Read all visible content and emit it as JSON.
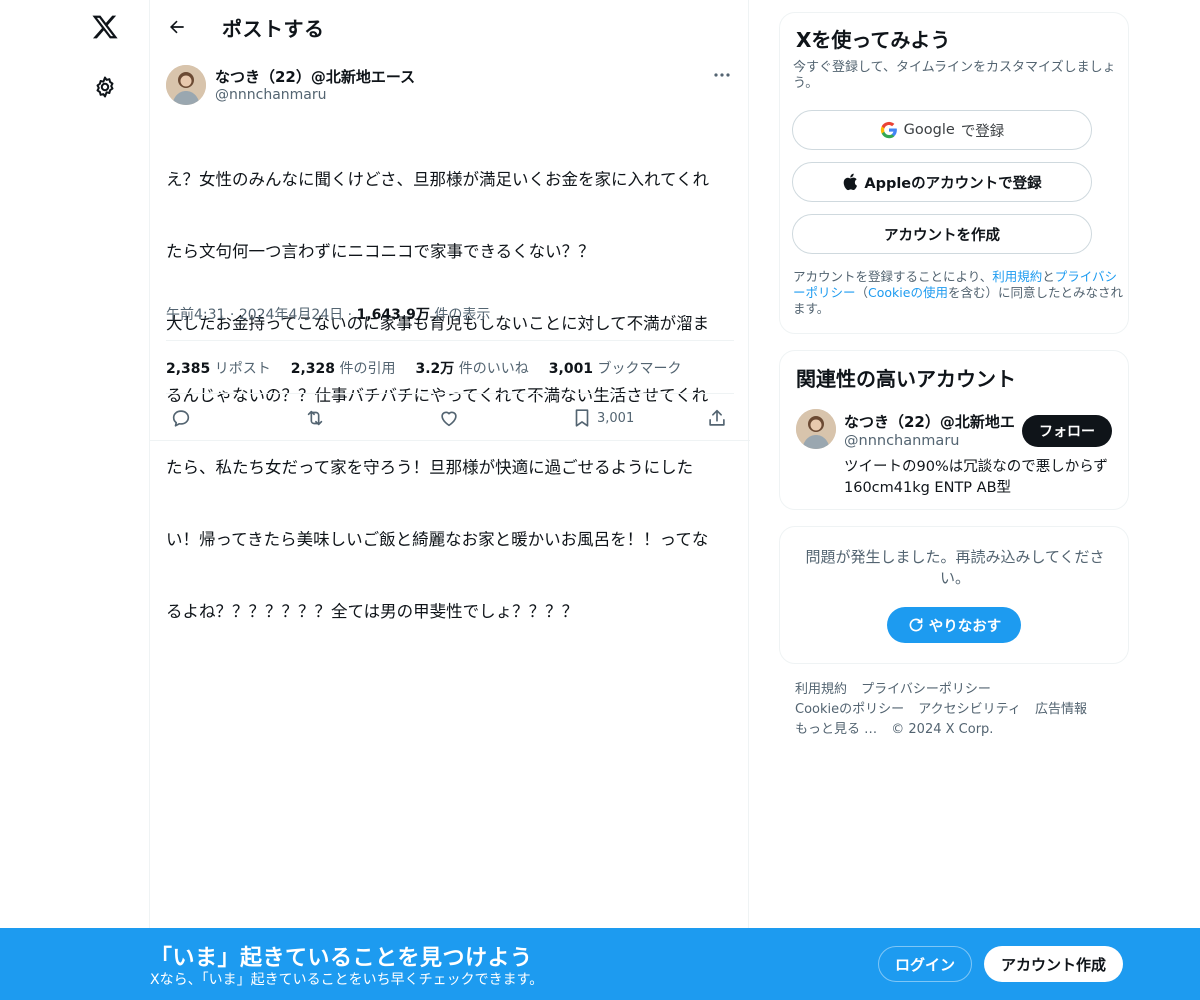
{
  "nav": {
    "logo_icon": "x-logo-icon",
    "settings_icon": "gear-icon"
  },
  "header": {
    "title": "ポストする",
    "back_icon": "arrow-left-icon"
  },
  "post": {
    "author_name": "なつき（22）@北新地エース",
    "author_handle": "@nnnchanmaru",
    "text_lines": [
      "え？女性のみんなに聞くけどさ、旦那様が満足いくお金を家に入れてくれ",
      "たら文句何一つ言わずにニコニコで家事できるくない？？",
      "大したお金持ってこないのに家事も育児もしないことに対して不満が溜ま",
      "るんじゃないの？？仕事バチバチにやってくれて不満ない生活させてくれ",
      "たら、私たち女だって家を守ろう！旦那様が快適に過ごせるようにした",
      "い！帰ってきたら美味しいご飯と綺麗なお家と暖かいお風呂を！！ってな",
      "るよね？？？？？？？全ては男の甲斐性でしょ？？？？"
    ],
    "time": "午前4:31",
    "date": "2024年4月24日",
    "views_count": "1,643.9万",
    "views_label": "件の表示",
    "stats": {
      "reposts_count": "2,385",
      "reposts_label": "リポスト",
      "quotes_count": "2,328",
      "quotes_label": "件の引用",
      "likes_count": "3.2万",
      "likes_label": "件のいいね",
      "bookmarks_count": "3,001",
      "bookmarks_label": "ブックマーク"
    },
    "actions": {
      "bookmark_count": "3,001"
    }
  },
  "signup_card": {
    "title": "Xを使ってみよう",
    "subtitle": "今すぐ登録して、タイムラインをカスタマイズしましょう。",
    "google_label_brand": "Google",
    "google_label_rest": "で登録",
    "apple_label": "Appleのアカウントで登録",
    "create_account_label": "アカウントを作成",
    "legal_prefix": "アカウントを登録することにより、",
    "legal_terms": "利用規約",
    "legal_and": "と",
    "legal_privacy": "プライバシーポリシー",
    "legal_paren_open": "（",
    "legal_cookie": "Cookieの使用",
    "legal_suffix": "を含む）に同意したとみなされます。"
  },
  "related_card": {
    "title": "関連性の高いアカウント",
    "account_name": "なつき（22）@北新地エ",
    "account_handle": "@nnnchanmaru",
    "follow_label": "フォロー",
    "account_bio": "ツイートの90%は冗談なので悪しからず 160cm41kg ENTP AB型"
  },
  "error_card": {
    "message": "問題が発生しました。再読み込みしてください。",
    "retry_label": "やりなおす"
  },
  "footer": {
    "links": [
      "利用規約",
      "プライバシーポリシー",
      "Cookieのポリシー",
      "アクセシビリティ",
      "広告情報",
      "もっと見る …"
    ],
    "copyright": "© 2024 X Corp."
  },
  "banner": {
    "title": "「いま」起きていることを見つけよう",
    "subtitle": "Xなら、「いま」起きていることをいち早くチェックできます。",
    "login_label": "ログイン",
    "signup_label": "アカウント作成"
  },
  "colors": {
    "accent": "#1d9bf0",
    "text": "#0f1419",
    "muted": "#536471",
    "border": "#eff3f4"
  }
}
